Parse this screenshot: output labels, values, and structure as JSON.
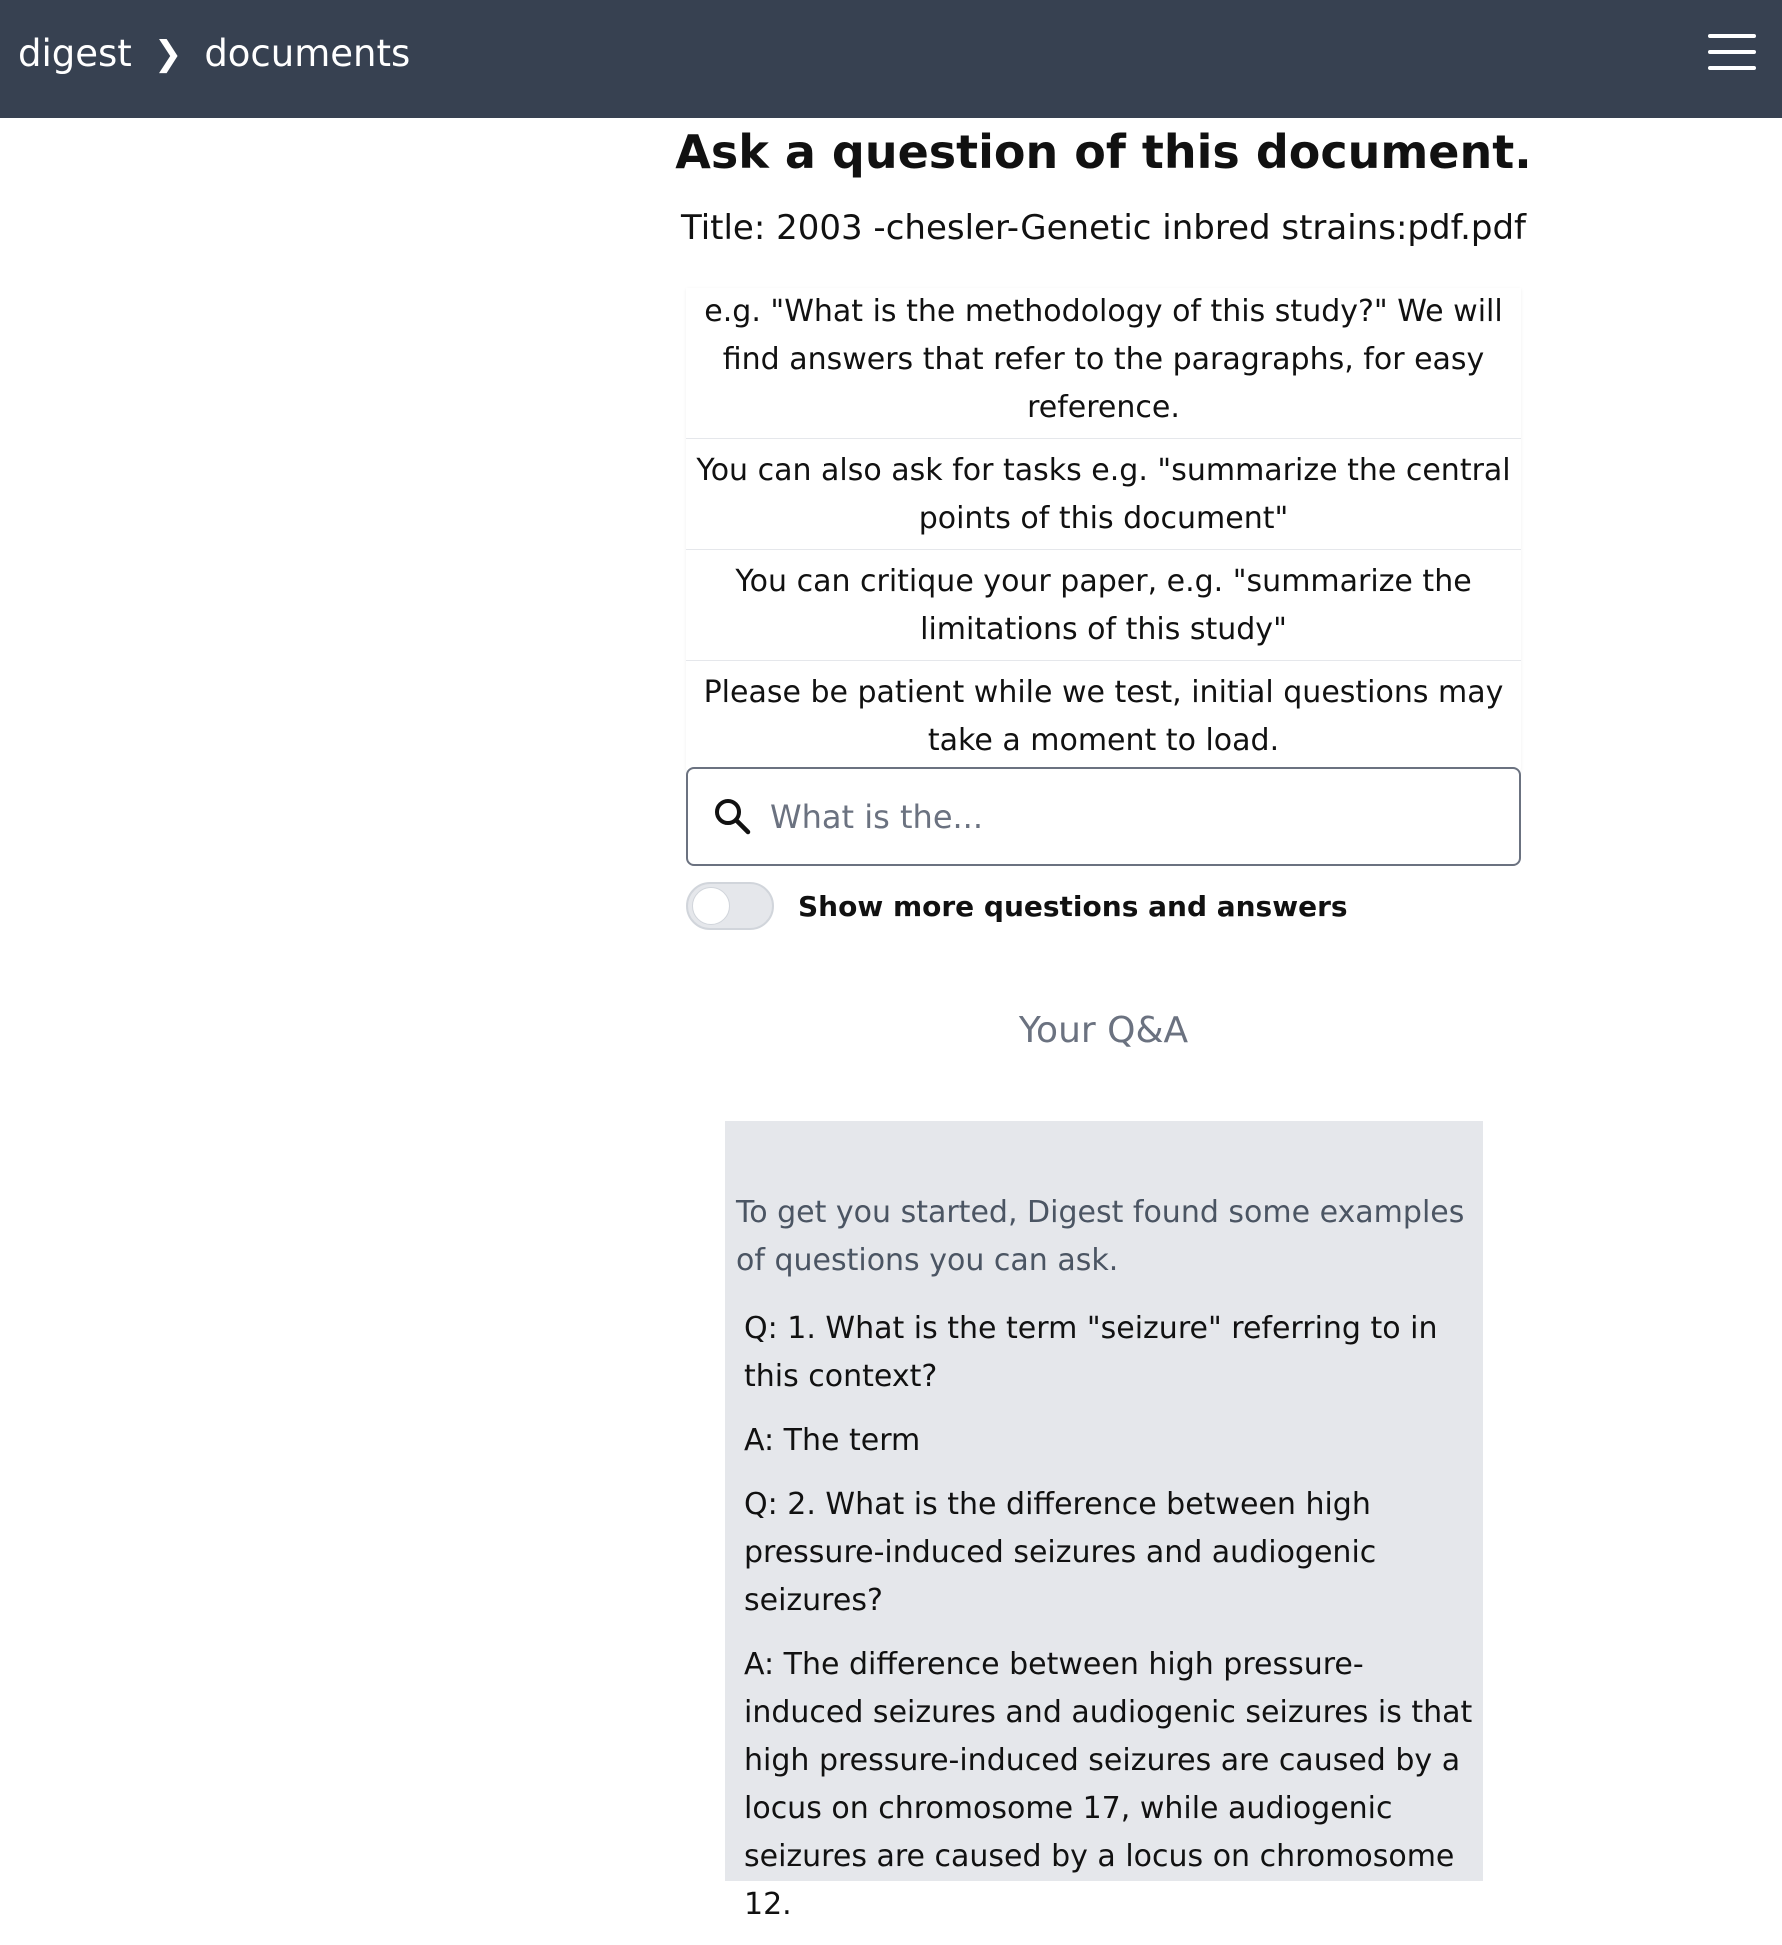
{
  "header": {
    "crumbs": [
      "digest",
      "documents"
    ],
    "separator": "❯",
    "menu_icon": "hamburger-menu-icon"
  },
  "main": {
    "heading": "Ask a question of this document.",
    "doc_title": "Title: 2003 -chesler-Genetic inbred strains:pdf.pdf",
    "tips": [
      "e.g. \"What is the methodology of this study?\" We will find answers that refer to the paragraphs, for easy reference.",
      "You can also ask for tasks e.g. \"summarize the central points of this document\"",
      "You can critique your paper, e.g. \"summarize the limitations of this study\"",
      "Please be patient while we test, initial questions may take a moment to load."
    ],
    "search": {
      "placeholder": "What is the...",
      "value": "",
      "icon": "search-icon"
    },
    "toggle": {
      "label": "Show more questions and answers",
      "on": false
    }
  },
  "qa": {
    "heading": "Your Q&A",
    "intro": "To get you started, Digest found some examples of questions you can ask.",
    "items": [
      "Q: 1. What is the term \"seizure\" referring to in this context?",
      "A: The term",
      "Q: 2. What is the difference between high pressure-induced seizures and audiogenic seizures?",
      "A: The difference between high pressure-induced seizures and audiogenic seizures is that high pressure-induced seizures are caused by a locus on chromosome 17, while audiogenic seizures are caused by a locus on chromosome 12."
    ]
  },
  "colors": {
    "header_bg": "#374151",
    "card_bg": "#e5e7eb",
    "muted_text": "#6b7280"
  }
}
